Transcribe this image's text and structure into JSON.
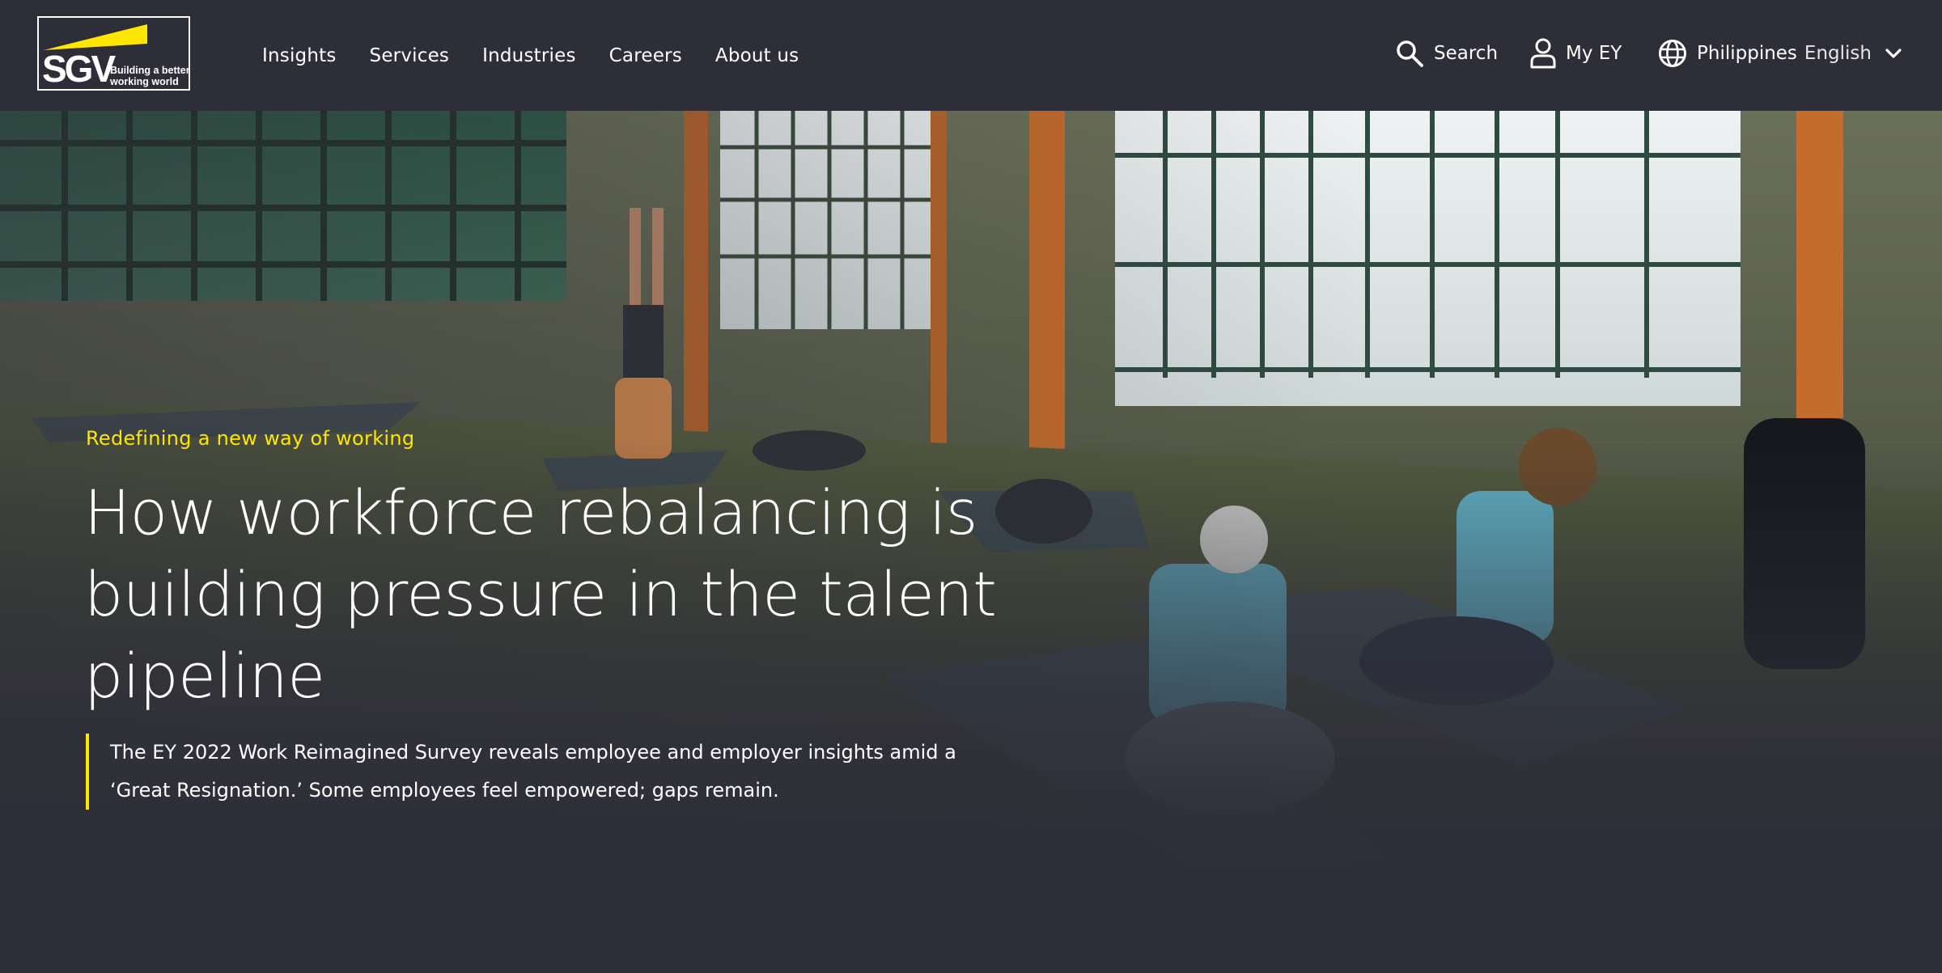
{
  "brand": {
    "logo_text": "SGV",
    "tagline_line1": "Building a better",
    "tagline_line2": "working world",
    "accent_color": "#ffe600",
    "background_color": "#2e2e38"
  },
  "nav": {
    "items": [
      {
        "label": "Insights"
      },
      {
        "label": "Services"
      },
      {
        "label": "Industries"
      },
      {
        "label": "Careers"
      },
      {
        "label": "About us"
      }
    ]
  },
  "utility": {
    "search_label": "Search",
    "search_icon": "search-icon",
    "account_label": "My EY",
    "account_icon": "user-icon",
    "country_label": "Philippines",
    "language_label": "English",
    "globe_icon": "globe-icon",
    "chevron_icon": "chevron-down-icon"
  },
  "hero": {
    "eyebrow": "Redefining a new way of working",
    "headline_line1": "How workforce rebalancing is",
    "headline_line2": "building pressure in the talent",
    "headline_line3": "pipeline",
    "summary_line1": "The EY 2022 Work Reimagined Survey reveals employee and employer insights amid a",
    "summary_line2": "‘Great Resignation.’ Some employees feel empowered; gaps remain."
  }
}
